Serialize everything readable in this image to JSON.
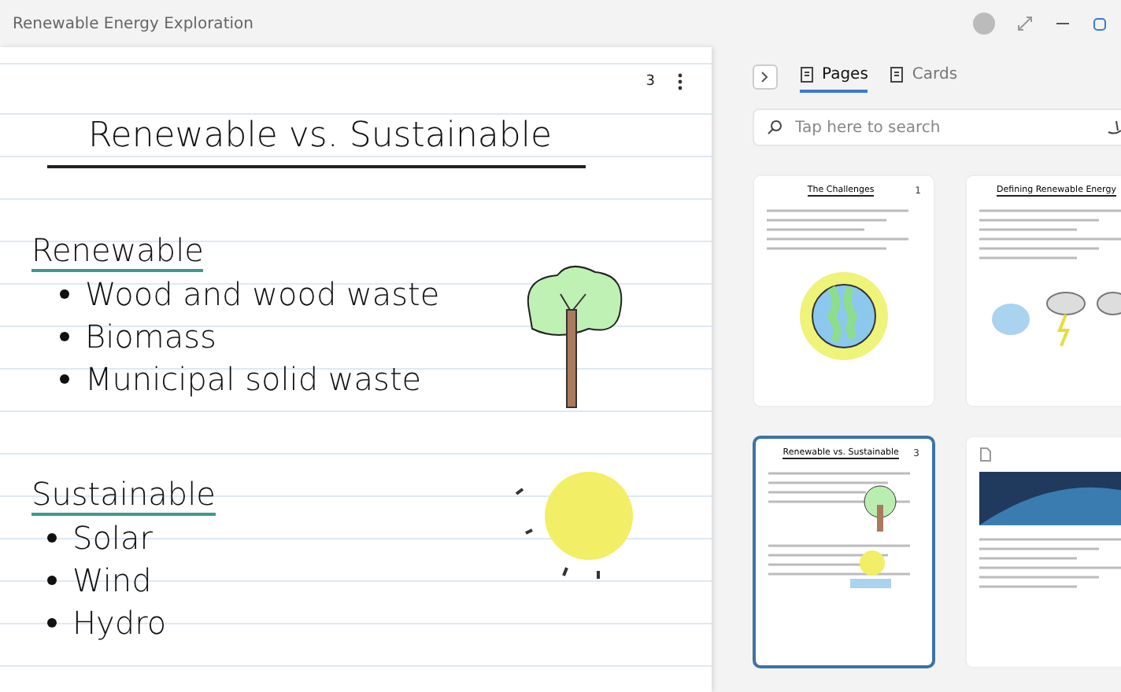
{
  "window": {
    "title": "Renewable Energy Exploration"
  },
  "note": {
    "page_number": "3",
    "title": "Renewable vs. Sustainable",
    "sections": [
      {
        "heading": "Renewable",
        "items": [
          "Wood and wood waste",
          "Biomass",
          "Municipal solid waste"
        ]
      },
      {
        "heading": "Sustainable",
        "items": [
          "Solar",
          "Wind",
          "Hydro"
        ]
      }
    ]
  },
  "sidebar": {
    "tabs": [
      {
        "label": "Pages",
        "selected": true
      },
      {
        "label": "Cards",
        "selected": false
      }
    ],
    "search": {
      "placeholder": "Tap here to search"
    },
    "pages": [
      {
        "kind": "earth",
        "title": "The Challenges",
        "number": "1",
        "selected": false
      },
      {
        "kind": "weather",
        "title": "Defining Renewable Energy",
        "selected": false
      },
      {
        "kind": "note",
        "title": "Renewable vs. Sustainable",
        "number": "3",
        "selected": true
      },
      {
        "kind": "pdf",
        "selected": false
      }
    ]
  }
}
